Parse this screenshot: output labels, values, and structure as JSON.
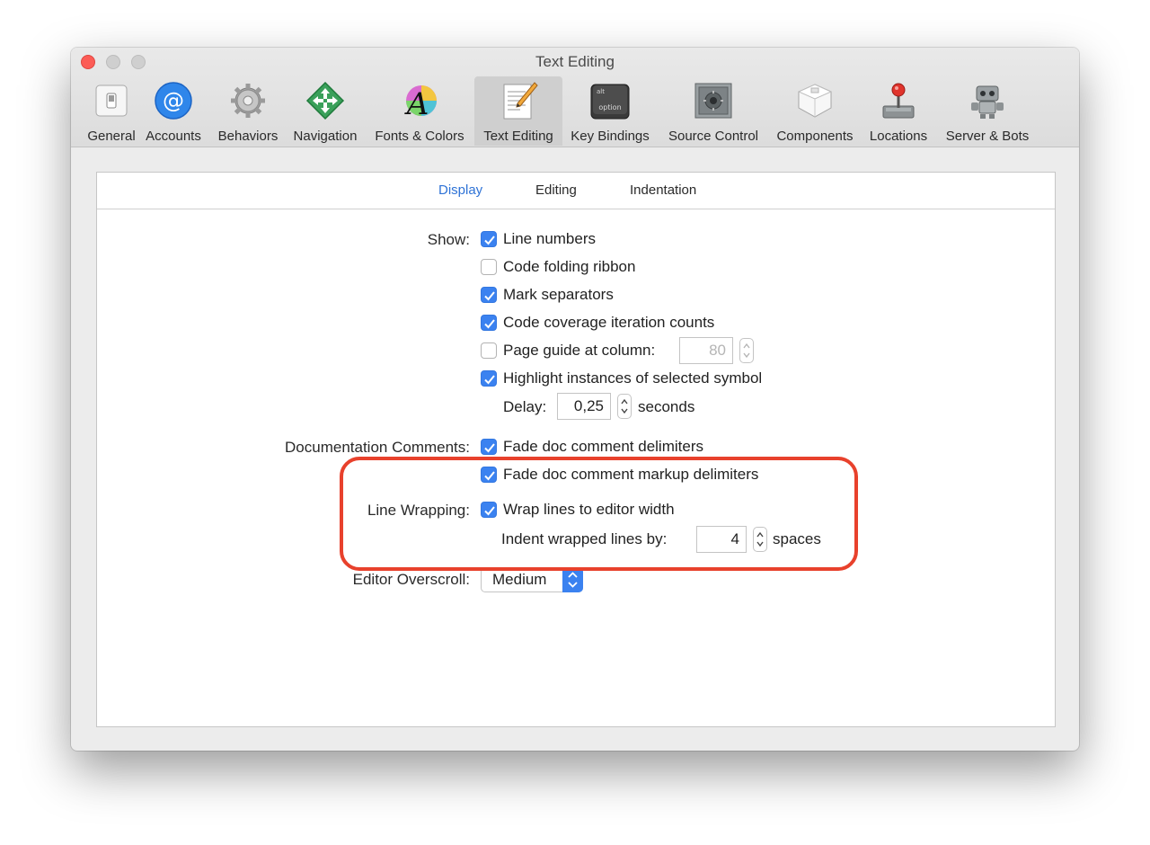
{
  "window": {
    "title": "Text Editing"
  },
  "toolbar": {
    "items": [
      {
        "label": "General",
        "icon": "switch-icon"
      },
      {
        "label": "Accounts",
        "icon": "at-sign-icon"
      },
      {
        "label": "Behaviors",
        "icon": "gear-icon"
      },
      {
        "label": "Navigation",
        "icon": "arrows-icon"
      },
      {
        "label": "Fonts & Colors",
        "icon": "font-palette-icon"
      },
      {
        "label": "Text Editing",
        "icon": "pencil-document-icon"
      },
      {
        "label": "Key Bindings",
        "icon": "keyboard-key-icon"
      },
      {
        "label": "Source Control",
        "icon": "safe-icon"
      },
      {
        "label": "Components",
        "icon": "box-icon"
      },
      {
        "label": "Locations",
        "icon": "joystick-icon"
      },
      {
        "label": "Server & Bots",
        "icon": "robot-icon"
      }
    ],
    "selected": "Text Editing",
    "key_icon": {
      "top_text": "alt",
      "bottom_text": "option"
    }
  },
  "tabs": {
    "display": "Display",
    "editing": "Editing",
    "indentation": "Indentation",
    "active": "Display"
  },
  "show": {
    "label": "Show:",
    "line_numbers": {
      "label": "Line numbers",
      "checked": true
    },
    "code_folding": {
      "label": "Code folding ribbon",
      "checked": false
    },
    "mark_separators": {
      "label": "Mark separators",
      "checked": true
    },
    "code_coverage": {
      "label": "Code coverage iteration counts",
      "checked": true
    },
    "page_guide": {
      "label": "Page guide at column:",
      "checked": false,
      "value": "80"
    },
    "highlight_instances": {
      "label": "Highlight instances of selected symbol",
      "checked": true
    },
    "delay": {
      "label": "Delay:",
      "value": "0,25",
      "unit": "seconds"
    }
  },
  "doc_comments": {
    "label": "Documentation Comments:",
    "fade_delimiters": {
      "label": "Fade doc comment delimiters",
      "checked": true
    },
    "fade_markup": {
      "label": "Fade doc comment markup delimiters",
      "checked": true
    }
  },
  "line_wrapping": {
    "label": "Line Wrapping:",
    "wrap": {
      "label": "Wrap lines to editor width",
      "checked": true
    },
    "indent": {
      "label": "Indent wrapped lines by:",
      "value": "4",
      "unit": "spaces"
    }
  },
  "overscroll": {
    "label": "Editor Overscroll:",
    "value": "Medium"
  },
  "colors": {
    "accent": "#3b82f0",
    "highlight": "#e8412c",
    "active_tab": "#2f73d6"
  }
}
